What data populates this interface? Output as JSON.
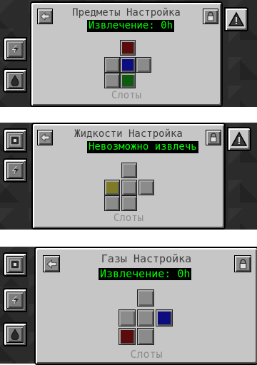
{
  "screens": [
    {
      "title": "Предметы Настройка",
      "status": "Извлечение: 0h",
      "status_color": "#00ff00",
      "slots_label": "Слоты",
      "slot_colors": {
        "top": "#5a0c0c",
        "left": "#8b8b8b",
        "center": "#0d0d80",
        "right": "#8b8b8b",
        "bottom_left": "#8b8b8b",
        "bottom": "#0e5a0e"
      }
    },
    {
      "title": "Жидкости Настройка",
      "status": "Невозможно извлечь",
      "status_color": "#00ff00",
      "slots_label": "Слоты",
      "slot_colors": {
        "top": "#8b8b8b",
        "left": "#7f7a26",
        "center": "#8b8b8b",
        "right": "#8b8b8b",
        "bottom_left": "#8b8b8b",
        "bottom": "#8b8b8b"
      }
    },
    {
      "title": "Газы Настройка",
      "status": "Извлечение: 0h",
      "status_color": "#00ff00",
      "slots_label": "Слоты",
      "slot_colors": {
        "top": "#8b8b8b",
        "left": "#8b8b8b",
        "center": "#8b8b8b",
        "right": "#0d0d80",
        "bottom_left": "#5a0c0c",
        "bottom": "#8b8b8b"
      }
    }
  ],
  "icons": {
    "back": "back-arrow-icon",
    "lock": "padlock-icon",
    "warning": "warning-triangle-icon",
    "energy": "lightning-icon",
    "fluid": "drop-icon",
    "item": "item-slot-icon"
  }
}
